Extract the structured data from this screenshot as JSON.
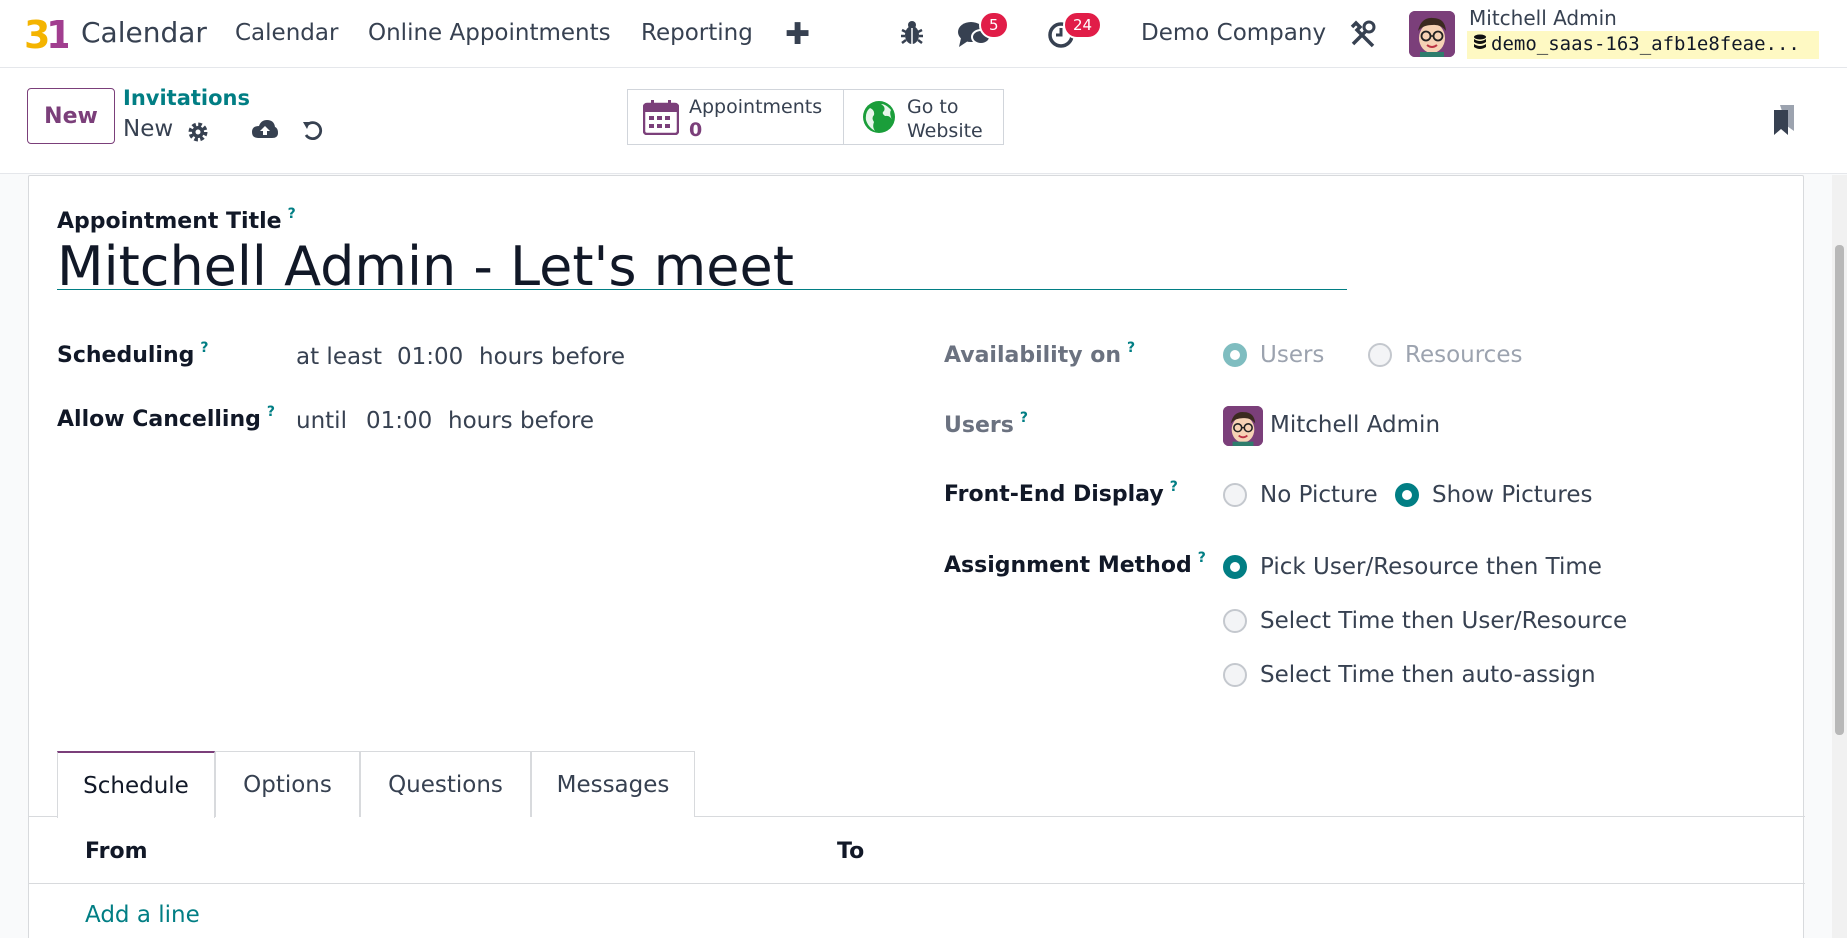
{
  "navbar": {
    "logo_text": "31",
    "app_name": "Calendar",
    "menu": [
      "Calendar",
      "Online Appointments",
      "Reporting"
    ],
    "plus": "✚",
    "messages_badge": "5",
    "activities_badge": "24",
    "company": "Demo Company",
    "user_name": "Mitchell Admin",
    "database": "demo_saas-163_afb1e8feae..."
  },
  "control_panel": {
    "new_button": "New",
    "breadcrumb_parent": "Invitations",
    "record_name": "New",
    "smart_buttons": {
      "appointments_label": "Appointments",
      "appointments_count": "0",
      "website_line1": "Go to",
      "website_line2": "Website"
    }
  },
  "form": {
    "title_label": "Appointment Title",
    "title_value": "Mitchell Admin - Let's meet",
    "help_mark": "?",
    "scheduling": {
      "label": "Scheduling",
      "prefix": "at least",
      "value": "01:00",
      "suffix": "hours before"
    },
    "cancelling": {
      "label": "Allow Cancelling",
      "prefix": "until",
      "value": "01:00",
      "suffix": "hours before"
    },
    "availability": {
      "label": "Availability on",
      "options": [
        "Users",
        "Resources"
      ],
      "selected": "Users"
    },
    "users": {
      "label": "Users",
      "value": "Mitchell Admin"
    },
    "frontend_display": {
      "label": "Front-End Display",
      "options": [
        "No Picture",
        "Show Pictures"
      ],
      "selected": "Show Pictures"
    },
    "assignment": {
      "label": "Assignment Method",
      "options": [
        "Pick User/Resource then Time",
        "Select Time then User/Resource",
        "Select Time then auto-assign"
      ],
      "selected": "Pick User/Resource then Time"
    }
  },
  "tabs": [
    "Schedule",
    "Options",
    "Questions",
    "Messages"
  ],
  "active_tab": "Schedule",
  "schedule_table": {
    "columns": [
      "From",
      "To"
    ],
    "add_line": "Add a line"
  },
  "colors": {
    "brand": "#7b3f7a",
    "accent": "#017e84",
    "badge": "#e11d48"
  }
}
